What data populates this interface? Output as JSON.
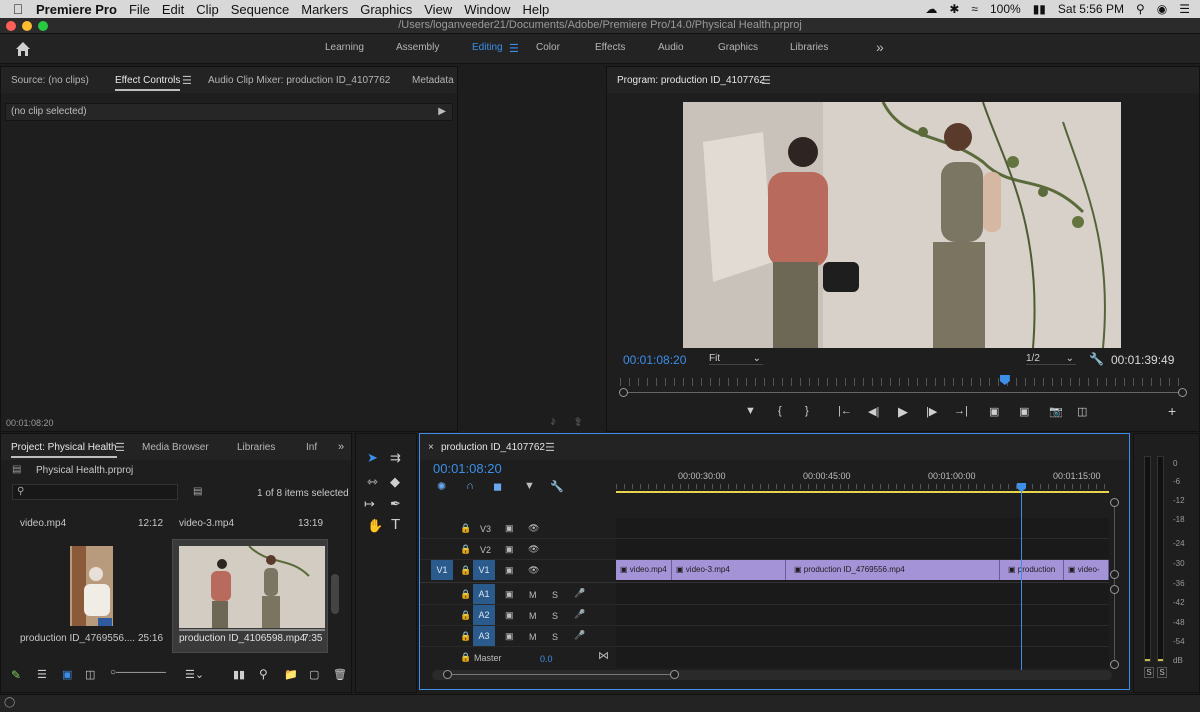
{
  "menubar": {
    "app": "Premiere Pro",
    "items": [
      "File",
      "Edit",
      "Clip",
      "Sequence",
      "Markers",
      "Graphics",
      "View",
      "Window",
      "Help"
    ],
    "battery": "100%",
    "clock": "Sat 5:56 PM"
  },
  "window": {
    "path": "/Users/loganveeder21/Documents/Adobe/Premiere Pro/14.0/Physical Health.prproj"
  },
  "workspaces": [
    "Learning",
    "Assembly",
    "Editing",
    "Color",
    "Effects",
    "Audio",
    "Graphics",
    "Libraries"
  ],
  "source_panel": {
    "tabs": [
      "Source: (no clips)",
      "Effect Controls",
      "Audio Clip Mixer: production ID_4107762",
      "Metadata"
    ],
    "no_clip": "(no clip selected)",
    "timecode": "00:01:08:20"
  },
  "program": {
    "title": "Program: production ID_4107762",
    "timecode": "00:01:08:20",
    "duration": "00:01:39:49",
    "fit": "Fit",
    "resolution": "1/2",
    "playhead_fraction": 0.68
  },
  "project": {
    "tabs": [
      "Project: Physical Health",
      "Media Browser",
      "Libraries",
      "Inf"
    ],
    "file": "Physical Health.prproj",
    "items_selected": "1 of 8 items selected",
    "clips": [
      {
        "name": "video.mp4",
        "duration": "12:12"
      },
      {
        "name": "video-3.mp4",
        "duration": "13:19"
      },
      {
        "name": "production ID_4769556....",
        "duration": "25:16"
      },
      {
        "name": "production ID_4106598.mp4",
        "duration": "7:35"
      }
    ]
  },
  "timeline": {
    "title": "production ID_4107762",
    "timecode": "00:01:08:20",
    "ruler": [
      "00:00:30:00",
      "00:00:45:00",
      "00:01:00:00",
      "00:01:15:00"
    ],
    "tracks": {
      "video": [
        "V3",
        "V2",
        "V1"
      ],
      "audio": [
        "A1",
        "A2",
        "A3"
      ],
      "source_patch": "V1",
      "master": "Master",
      "master_value": "0.0"
    },
    "track_buttons": {
      "mute": "M",
      "solo": "S"
    },
    "clips": [
      "video.mp4",
      "video-3.mp4",
      "production ID_4769556.mp4",
      "production",
      "video-"
    ]
  },
  "meters": {
    "labels": [
      "0",
      "-6",
      "-12",
      "-18",
      "-24",
      "-30",
      "-36",
      "-42",
      "-48",
      "-54",
      "dB"
    ],
    "solo": [
      "S",
      "S"
    ]
  },
  "colors": {
    "accent": "#3c8ee8",
    "clip": "#a593d8",
    "track_button": "#2b5b8c"
  }
}
